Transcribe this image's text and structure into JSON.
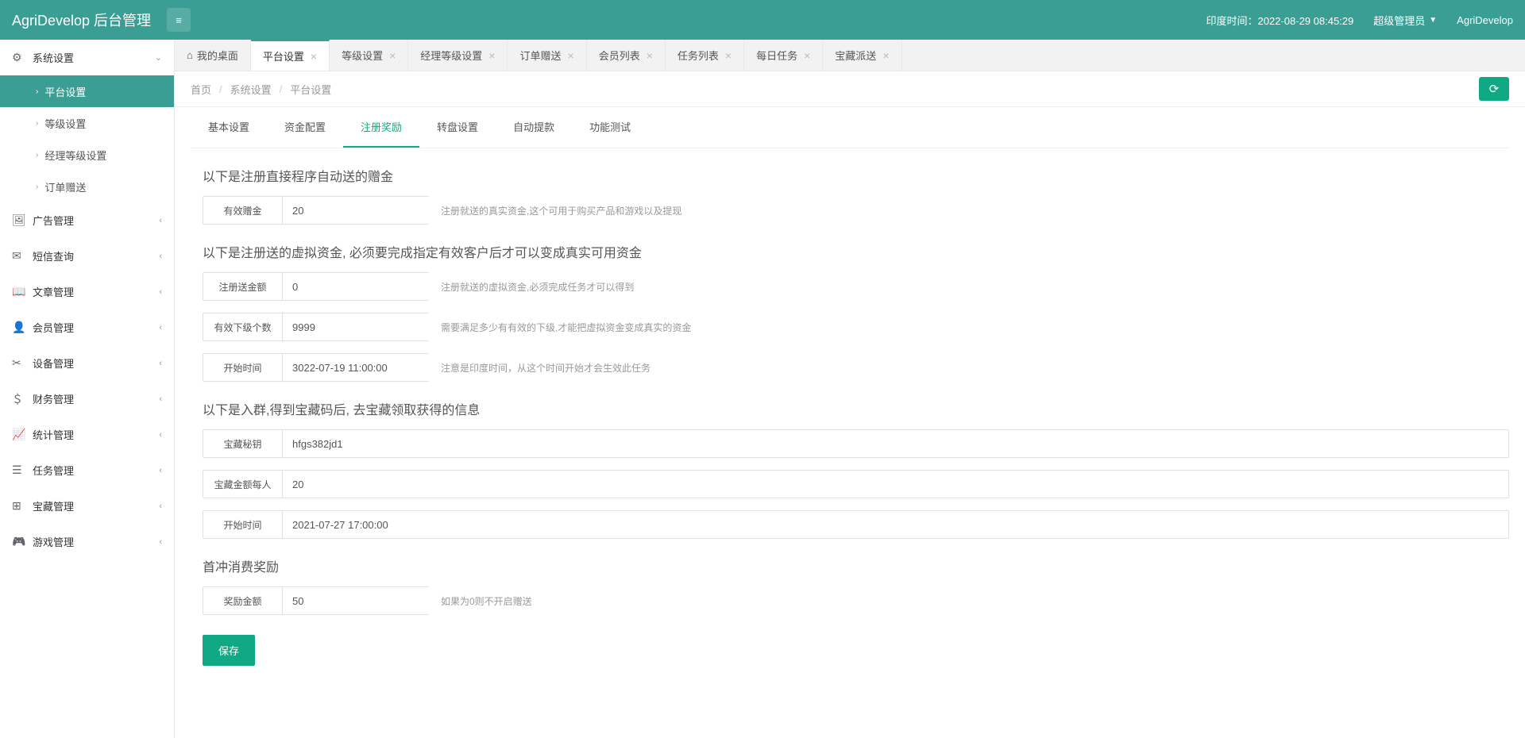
{
  "header": {
    "logo": "AgriDevelop 后台管理",
    "time_label": "印度时间：",
    "time_value": "2022-08-29 08:45:29",
    "user_role": "超级管理员",
    "app_name": "AgriDevelop"
  },
  "sidebar": {
    "groups": [
      {
        "icon": "⚙",
        "label": "系统设置",
        "expanded": true,
        "children": [
          {
            "label": "平台设置",
            "active": true
          },
          {
            "label": "等级设置"
          },
          {
            "label": "经理等级设置"
          },
          {
            "label": "订单赠送"
          }
        ]
      },
      {
        "icon": "🖼",
        "label": "广告管理"
      },
      {
        "icon": "✉",
        "label": "短信查询"
      },
      {
        "icon": "📖",
        "label": "文章管理"
      },
      {
        "icon": "👤",
        "label": "会员管理"
      },
      {
        "icon": "✂",
        "label": "设备管理"
      },
      {
        "icon": "＄",
        "label": "财务管理"
      },
      {
        "icon": "📈",
        "label": "统计管理"
      },
      {
        "icon": "☰",
        "label": "任务管理"
      },
      {
        "icon": "⊞",
        "label": "宝藏管理"
      },
      {
        "icon": "🎮",
        "label": "游戏管理"
      }
    ]
  },
  "tabs": [
    {
      "label": "我的桌面",
      "home": true
    },
    {
      "label": "平台设置",
      "active": true
    },
    {
      "label": "等级设置"
    },
    {
      "label": "经理等级设置"
    },
    {
      "label": "订单赠送"
    },
    {
      "label": "会员列表"
    },
    {
      "label": "任务列表"
    },
    {
      "label": "每日任务"
    },
    {
      "label": "宝藏派送"
    }
  ],
  "breadcrumb": [
    "首页",
    "系统设置",
    "平台设置"
  ],
  "inner_tabs": [
    {
      "label": "基本设置"
    },
    {
      "label": "资金配置"
    },
    {
      "label": "注册奖励",
      "active": true
    },
    {
      "label": "转盘设置"
    },
    {
      "label": "自动提款"
    },
    {
      "label": "功能测试"
    }
  ],
  "form": {
    "section1_title": "以下是注册直接程序自动送的赠金",
    "field1_label": "有效赠金",
    "field1_value": "20",
    "field1_help": "注册就送的真实资金,这个可用于购买产品和游戏以及提现",
    "section2_title": "以下是注册送的虚拟资金, 必须要完成指定有效客户后才可以变成真实可用资金",
    "field2_label": "注册送金额",
    "field2_value": "0",
    "field2_help": "注册就送的虚拟资金,必须完成任务才可以得到",
    "field3_label": "有效下级个数",
    "field3_value": "9999",
    "field3_help": "需要满足多少有有效的下级,才能把虚拟资金变成真实的资金",
    "field4_label": "开始时间",
    "field4_value": "3022-07-19 11:00:00",
    "field4_help": "注意是印度时间，从这个时间开始才会生效此任务",
    "section3_title": "以下是入群,得到宝藏码后, 去宝藏领取获得的信息",
    "field5_label": "宝藏秘钥",
    "field5_value": "hfgs382jd1",
    "field6_label": "宝藏金额每人",
    "field6_value": "20",
    "field7_label": "开始时间",
    "field7_value": "2021-07-27 17:00:00",
    "section4_title": "首冲消费奖励",
    "field8_label": "奖励金额",
    "field8_value": "50",
    "field8_help": "如果为0则不开启赠送",
    "save_label": "保存"
  }
}
